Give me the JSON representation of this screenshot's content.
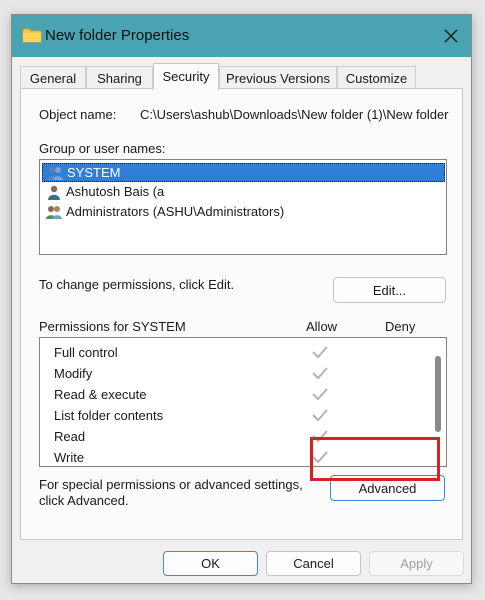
{
  "window": {
    "title": "New folder Properties",
    "title_icon": "folder-icon",
    "close_icon": "close-icon",
    "titlebar_color": "#4aa3b1"
  },
  "tabs": [
    {
      "label": "General"
    },
    {
      "label": "Sharing"
    },
    {
      "label": "Security",
      "active": true
    },
    {
      "label": "Previous Versions"
    },
    {
      "label": "Customize"
    }
  ],
  "security": {
    "object_name_label": "Object name:",
    "object_name_value": "C:\\Users\\ashub\\Downloads\\New folder (1)\\New folder",
    "group_label": "Group or user names:",
    "users": [
      {
        "name": "SYSTEM",
        "icon": "users-group-icon",
        "selected": true
      },
      {
        "name": "Ashutosh Bais (a",
        "icon": "user-icon"
      },
      {
        "name": "Administrators (ASHU\\Administrators)",
        "icon": "admin-group-icon"
      }
    ],
    "change_text": "To change permissions, click Edit.",
    "edit_button": "Edit...",
    "permissions_label": "Permissions for SYSTEM",
    "allow_header": "Allow",
    "deny_header": "Deny",
    "permissions": [
      {
        "name": "Full control",
        "allow": true
      },
      {
        "name": "Modify",
        "allow": true
      },
      {
        "name": "Read & execute",
        "allow": true
      },
      {
        "name": "List folder contents",
        "allow": true
      },
      {
        "name": "Read",
        "allow": true
      },
      {
        "name": "Write",
        "allow": true
      }
    ],
    "special_text_1": "For special permissions or advanced settings,",
    "special_text_2": "click Advanced.",
    "advanced_button": "Advanced",
    "highlight_color": "#d6202a"
  },
  "footer": {
    "ok": "OK",
    "cancel": "Cancel",
    "apply": "Apply"
  }
}
